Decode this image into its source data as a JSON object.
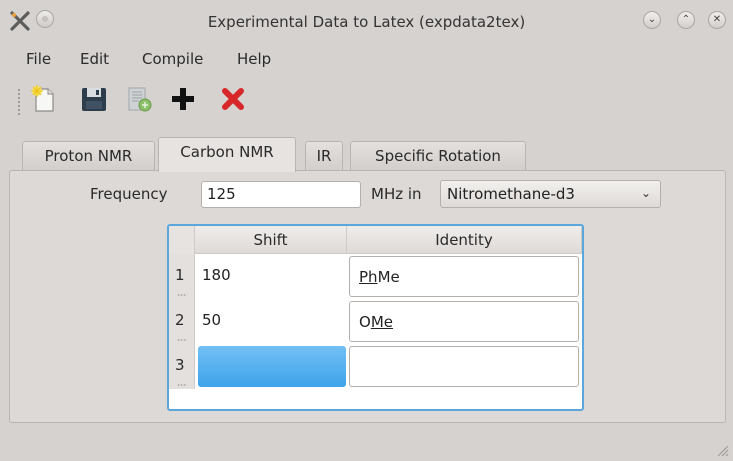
{
  "window": {
    "title": "Experimental Data to Latex (expdata2tex)"
  },
  "menubar": {
    "items": [
      "File",
      "Edit",
      "Compile",
      "Help"
    ]
  },
  "toolbar": {
    "buttons": [
      "new-document-icon",
      "save-icon",
      "export-icon",
      "add-icon",
      "delete-icon"
    ]
  },
  "tabs": [
    {
      "label": "Proton NMR",
      "active": false
    },
    {
      "label": "Carbon NMR",
      "active": true
    },
    {
      "label": "IR",
      "active": false
    },
    {
      "label": "Specific Rotation",
      "active": false
    }
  ],
  "form": {
    "frequency_label": "Frequency",
    "frequency_value": "125",
    "unit_label": "MHz in",
    "solvent_selected": "Nitromethane-d3"
  },
  "table": {
    "columns": [
      "Shift",
      "Identity"
    ],
    "rows": [
      {
        "num": "1",
        "shift": "180",
        "identity_u": "Ph",
        "identity_rest": "Me"
      },
      {
        "num": "2",
        "shift": "50",
        "identity_pre": "O",
        "identity_u": "Me"
      },
      {
        "num": "3",
        "shift": "",
        "identity": ""
      }
    ]
  },
  "colors": {
    "accent": "#5ba7dc",
    "selection": "#3ea3ea",
    "delete": "#d8272a"
  }
}
